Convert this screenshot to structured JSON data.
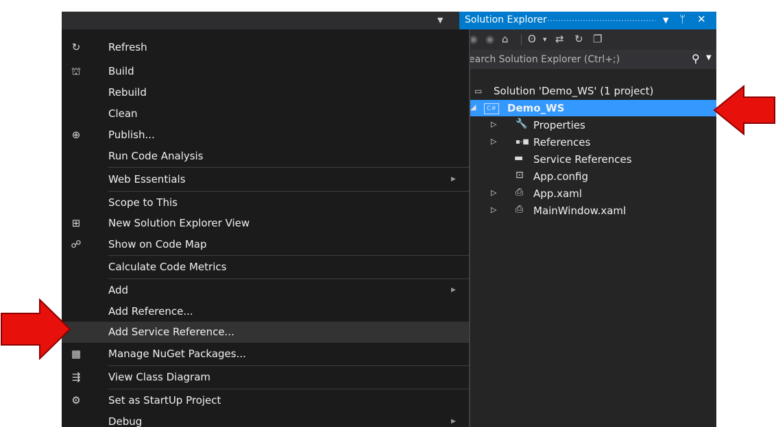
{
  "solution_explorer": {
    "title": "Solution Explorer",
    "title_buttons": [
      "▼",
      "ᛘ",
      "✕"
    ],
    "toolbar_icons": [
      "back-icon",
      "forward-icon",
      "home-icon",
      "history-icon",
      "dropdown-icon",
      "sync-icon",
      "refresh-icon",
      "collapse-icon"
    ],
    "search_placeholder": "earch Solution Explorer (Ctrl+;)",
    "tree": [
      {
        "label": "Solution 'Demo_WS' (1 project)",
        "icon": "solution-icon",
        "expander": ""
      },
      {
        "label": "Demo_WS",
        "icon": "csharp-project-icon",
        "expander": "◢",
        "selected": true
      },
      {
        "label": "Properties",
        "icon": "wrench-icon",
        "expander": "▷"
      },
      {
        "label": "References",
        "icon": "references-icon",
        "expander": "▷"
      },
      {
        "label": "Service References",
        "icon": "folder-icon",
        "expander": ""
      },
      {
        "label": "App.config",
        "icon": "config-file-icon",
        "expander": ""
      },
      {
        "label": "App.xaml",
        "icon": "xaml-file-icon",
        "expander": "▷"
      },
      {
        "label": "MainWindow.xaml",
        "icon": "xaml-file-icon",
        "expander": "▷"
      }
    ]
  },
  "context_menu": {
    "items": [
      {
        "label": "Refresh",
        "icon": "refresh-icon"
      },
      {
        "label": "Build",
        "icon": "build-icon"
      },
      {
        "label": "Rebuild"
      },
      {
        "label": "Clean"
      },
      {
        "label": "Publish...",
        "icon": "publish-icon"
      },
      {
        "label": "Run Code Analysis"
      },
      {
        "label": "Web Essentials",
        "submenu": true
      },
      {
        "label": "Scope to This"
      },
      {
        "label": "New Solution Explorer View",
        "icon": "new-view-icon"
      },
      {
        "label": "Show on Code Map",
        "icon": "code-map-icon"
      },
      {
        "label": "Calculate Code Metrics"
      },
      {
        "label": "Add",
        "submenu": true
      },
      {
        "label": "Add Reference..."
      },
      {
        "label": "Add Service Reference...",
        "highlighted": true
      },
      {
        "label": "Manage NuGet Packages...",
        "icon": "nuget-icon"
      },
      {
        "label": "View Class Diagram",
        "icon": "class-diagram-icon"
      },
      {
        "label": "Set as StartUp Project",
        "icon": "gear-icon"
      },
      {
        "label": "Debug",
        "submenu": true
      }
    ]
  },
  "annotations": {
    "arrow_color": "#e8100b",
    "arrow_outline": "#8a0000"
  }
}
